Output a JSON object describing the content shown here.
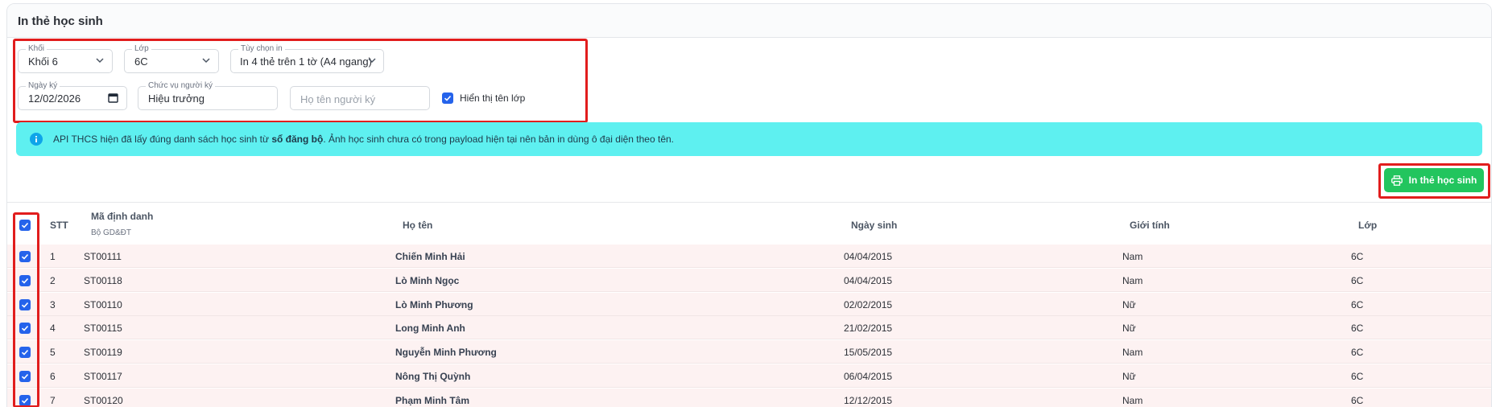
{
  "card": {
    "title": "In thẻ học sinh"
  },
  "filters": {
    "khoi": {
      "label": "Khối",
      "value": "Khối 6"
    },
    "lop": {
      "label": "Lớp",
      "value": "6C"
    },
    "tuy_chon": {
      "label": "Tùy chọn in",
      "value": "In 4 thẻ trên 1 tờ (A4 ngang)"
    },
    "ngay_ky": {
      "label": "Ngày ký",
      "value": "12/02/2026"
    },
    "chuc_vu": {
      "label": "Chức vụ người ký",
      "value": "Hiệu trưởng"
    },
    "ho_ten_nguoi_ky": {
      "placeholder": "Họ tên người ký"
    },
    "show_class_label": "Hiển thị tên lớp"
  },
  "alert": {
    "text_before": "API THCS hiện đã lấy đúng danh sách học sinh từ ",
    "text_bold": "sổ đăng bộ",
    "text_after": ". Ảnh học sinh chưa có trong payload hiện tại nên bản in dùng ô đại diện theo tên."
  },
  "print_button": {
    "label": "In thẻ học sinh"
  },
  "table": {
    "headers": {
      "stt": "STT",
      "ma_dinh_danh": "Mã định danh",
      "ma_dinh_danh_sub": "Bộ GD&ĐT",
      "ho_ten": "Họ tên",
      "ngay_sinh": "Ngày sinh",
      "gioi_tinh": "Giới tính",
      "lop": "Lớp"
    },
    "rows": [
      {
        "stt": "1",
        "ma": "ST00111",
        "ho_ten": "Chiến Minh Hải",
        "ngay_sinh": "04/04/2015",
        "gioi_tinh": "Nam",
        "lop": "6C"
      },
      {
        "stt": "2",
        "ma": "ST00118",
        "ho_ten": "Lò Minh Ngọc",
        "ngay_sinh": "04/04/2015",
        "gioi_tinh": "Nam",
        "lop": "6C"
      },
      {
        "stt": "3",
        "ma": "ST00110",
        "ho_ten": "Lò Minh Phương",
        "ngay_sinh": "02/02/2015",
        "gioi_tinh": "Nữ",
        "lop": "6C"
      },
      {
        "stt": "4",
        "ma": "ST00115",
        "ho_ten": "Long Minh Anh",
        "ngay_sinh": "21/02/2015",
        "gioi_tinh": "Nữ",
        "lop": "6C"
      },
      {
        "stt": "5",
        "ma": "ST00119",
        "ho_ten": "Nguyễn Minh Phương",
        "ngay_sinh": "15/05/2015",
        "gioi_tinh": "Nam",
        "lop": "6C"
      },
      {
        "stt": "6",
        "ma": "ST00117",
        "ho_ten": "Nông Thị Quỳnh",
        "ngay_sinh": "06/04/2015",
        "gioi_tinh": "Nữ",
        "lop": "6C"
      },
      {
        "stt": "7",
        "ma": "ST00120",
        "ho_ten": "Phạm Minh Tâm",
        "ngay_sinh": "12/12/2015",
        "gioi_tinh": "Nam",
        "lop": "6C"
      }
    ]
  },
  "colors": {
    "accent_blue": "#2563eb",
    "alert_bg": "#5ef0f0",
    "print_green": "#22c55e",
    "highlight_red": "#e11d1d",
    "row_bg": "#fdf2f2"
  }
}
